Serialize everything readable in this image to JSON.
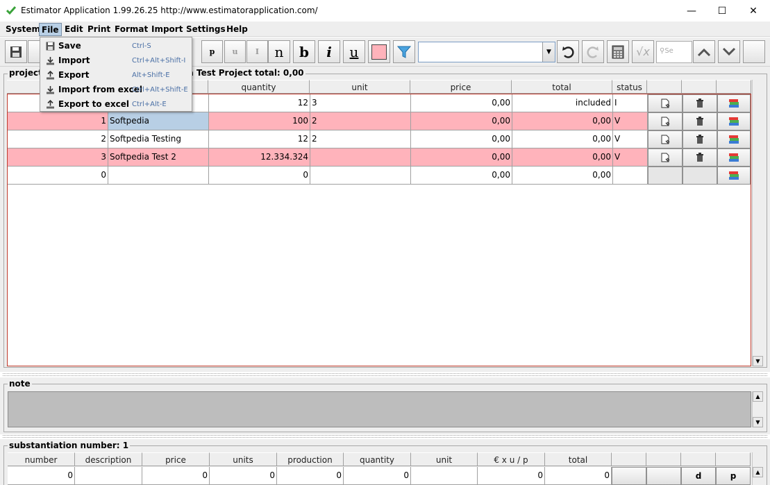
{
  "window": {
    "title": "Estimator Application 1.99.26.25 http://www.estimatorapplication.com/",
    "minimize": "—",
    "maximize": "☐",
    "close": "✕"
  },
  "menubar": {
    "items": [
      "System",
      "File",
      "Edit",
      "Print",
      "Format",
      "Import",
      "Settings",
      "Help"
    ]
  },
  "file_menu": {
    "items": [
      {
        "label": "Save",
        "shortcut": "Ctrl-S"
      },
      {
        "label": "Import",
        "shortcut": "Ctrl+Alt+Shift-I"
      },
      {
        "label": "Export",
        "shortcut": "Alt+Shift-E"
      },
      {
        "label": "Import from excel",
        "shortcut": "Ctrl+Alt+Shift-E"
      },
      {
        "label": "Export to excel",
        "shortcut": "Ctrl+Alt-E"
      }
    ]
  },
  "toolbar": {
    "p_label": "p",
    "u_small_label": "u",
    "i_small_label": "I",
    "n_label": "n",
    "b_label": "b",
    "i_label": "i",
    "u_label": "u",
    "search_placeholder": "Se",
    "color_swatch": "#ffb3bb"
  },
  "project": {
    "label_left": "project",
    "label_right": "dia Test Project total: 0,00",
    "columns": [
      "quantity",
      "unit",
      "price",
      "total",
      "status"
    ],
    "rows": [
      {
        "num": "",
        "name": "",
        "quantity": "12",
        "unit": "3",
        "price": "0,00",
        "total": "included",
        "status": "I",
        "pink": false,
        "actions": true
      },
      {
        "num": "1",
        "name": "Softpedia",
        "quantity": "100",
        "unit": "2",
        "price": "0,00",
        "total": "0,00",
        "status": "V",
        "pink": true,
        "actions": true
      },
      {
        "num": "2",
        "name": "Softpedia Testing",
        "quantity": "12",
        "unit": "2",
        "price": "0,00",
        "total": "0,00",
        "status": "V",
        "pink": false,
        "actions": true
      },
      {
        "num": "3",
        "name": "Softpedia Test 2",
        "quantity": "12.334.324",
        "unit": "",
        "price": "0,00",
        "total": "0,00",
        "status": "V",
        "pink": true,
        "actions": true
      },
      {
        "num": "0",
        "name": "",
        "quantity": "0",
        "unit": "",
        "price": "0,00",
        "total": "0,00",
        "status": "",
        "pink": false,
        "actions": false
      }
    ]
  },
  "note": {
    "label": "note"
  },
  "substantiation": {
    "label": "substantiation number: 1",
    "columns": [
      "number",
      "description",
      "price",
      "units",
      "production",
      "quantity",
      "unit",
      "€ x u / p",
      "total"
    ],
    "first_row": [
      "0",
      "",
      "0",
      "0",
      "0",
      "0",
      "",
      "0",
      "0"
    ],
    "action_labels": [
      "",
      "d",
      "p"
    ]
  },
  "colors": {
    "pink_row": "#ffb3bb",
    "selected_cell": "#b8cfe5",
    "border_red": "#c0392b"
  }
}
